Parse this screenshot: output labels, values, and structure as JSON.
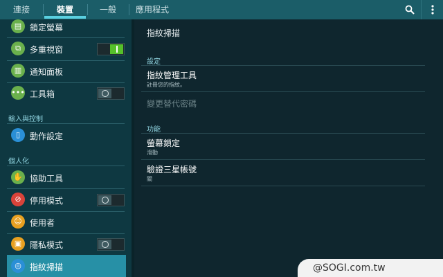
{
  "tabs": [
    {
      "label": "連接"
    },
    {
      "label": "裝置"
    },
    {
      "label": "一般"
    },
    {
      "label": "應用程式"
    }
  ],
  "active_tab": "裝置",
  "sidebar": {
    "items": [
      {
        "label": "鎖定螢幕",
        "icon": "lock-screen-icon",
        "color": "#6ab04c"
      },
      {
        "label": "多重視窗",
        "icon": "multi-window-icon",
        "color": "#6ab04c",
        "toggle": "on"
      },
      {
        "label": "通知面板",
        "icon": "notification-panel-icon",
        "color": "#6ab04c"
      },
      {
        "label": "工具箱",
        "icon": "toolbox-icon",
        "color": "#6ab04c",
        "toggle": "off"
      }
    ],
    "section_input": "輸入與控制",
    "input_items": [
      {
        "label": "動作設定",
        "icon": "motion-icon",
        "color": "#2a8fd6"
      }
    ],
    "section_personal": "個人化",
    "personal_items": [
      {
        "label": "協助工具",
        "icon": "accessibility-icon",
        "color": "#6ab04c"
      },
      {
        "label": "停用模式",
        "icon": "blocking-mode-icon",
        "color": "#d9433a",
        "toggle": "off"
      },
      {
        "label": "使用者",
        "icon": "users-icon",
        "color": "#e8a020"
      },
      {
        "label": "隱私模式",
        "icon": "private-mode-icon",
        "color": "#e8a020",
        "toggle": "off"
      },
      {
        "label": "指紋掃描",
        "icon": "fingerprint-icon",
        "color": "#2a8fd6",
        "selected": true
      }
    ]
  },
  "main": {
    "title": "指紋掃描",
    "section_settings": "設定",
    "fingerprint_manager": {
      "label": "指紋管理工具",
      "sub": "註冊您的指紋。"
    },
    "alt_password": {
      "label": "變更替代密碼"
    },
    "section_features": "功能",
    "screen_lock": {
      "label": "螢幕鎖定",
      "sub": "滑動"
    },
    "verify_samsung": {
      "label": "驗證三星帳號",
      "sub": "關"
    }
  },
  "watermark": "@SOGI.com.tw"
}
